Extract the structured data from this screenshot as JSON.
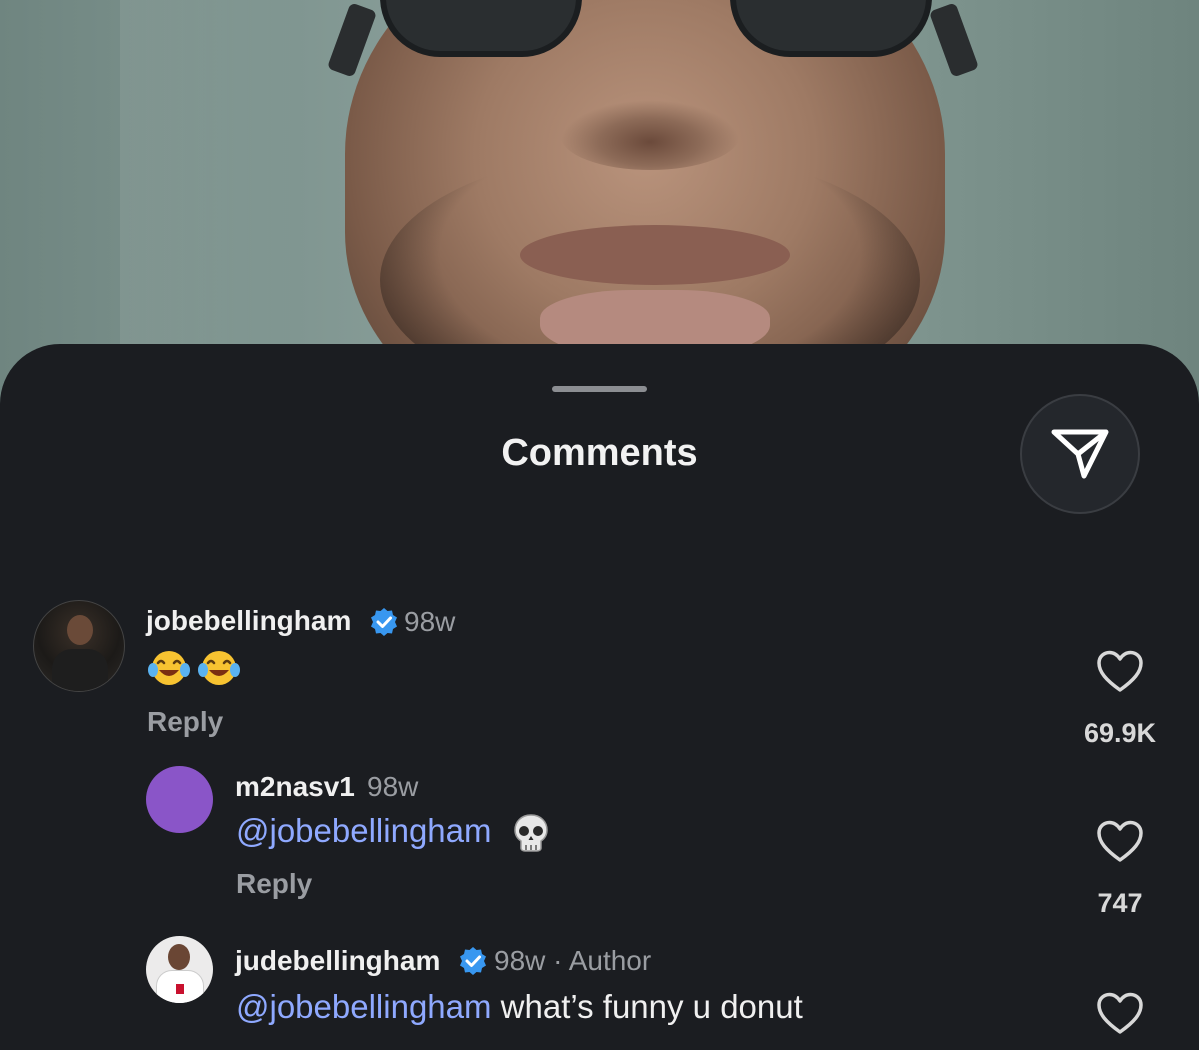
{
  "sheet": {
    "title": "Comments"
  },
  "icons": {
    "share": "send-icon",
    "verified": "verified-badge-icon",
    "like": "heart-icon"
  },
  "colors": {
    "sheet_bg": "#1b1d21",
    "mention": "#8fa9ff",
    "verified": "#3897f0"
  },
  "comments": [
    {
      "username": "jobebellingham",
      "verified": true,
      "time": "98w",
      "emojis": [
        "face-with-tears-of-joy",
        "face-with-tears-of-joy"
      ],
      "reply": "Reply",
      "likes": "69.9K"
    },
    {
      "username": "m2nasv1",
      "verified": false,
      "time": "98w",
      "mention": "@jobebellingham",
      "emoji": "skull",
      "reply": "Reply",
      "likes": "747"
    },
    {
      "username": "judebellingham",
      "verified": true,
      "time": "98w · Author",
      "mention": "@jobebellingham",
      "text": " what’s funny u donut"
    }
  ]
}
